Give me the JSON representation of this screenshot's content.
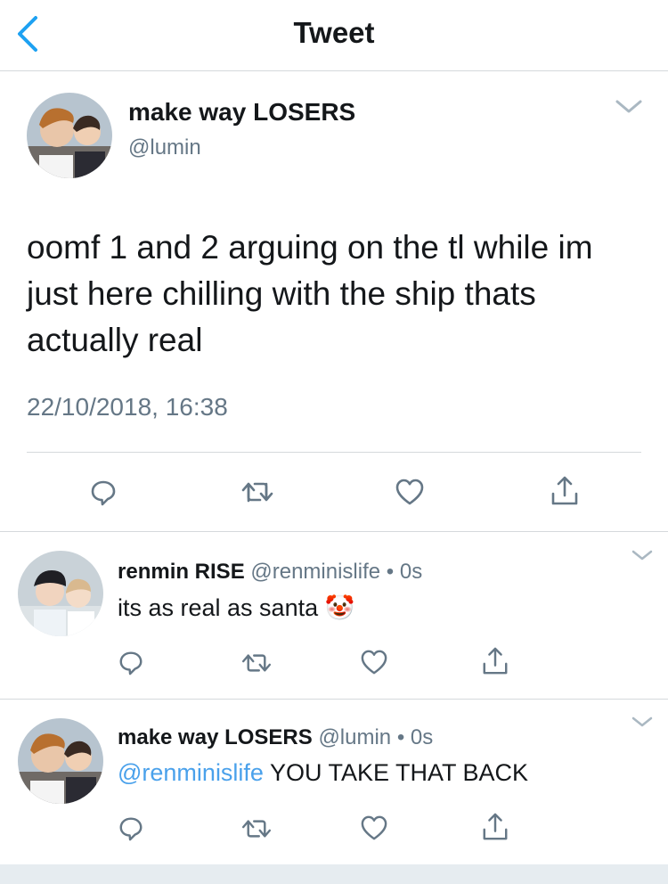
{
  "nav": {
    "title": "Tweet",
    "back_icon": "chevron-left-icon"
  },
  "colors": {
    "accent": "#1da1f2",
    "mention": "#4aa1eb",
    "muted": "#657786",
    "text": "#14171a",
    "divider": "#d5d9dc"
  },
  "tweet": {
    "author_name": "make way LOSERS",
    "author_handle": "@lumin",
    "text": "oomf 1 and 2 arguing on the tl while im just here chilling with the ship thats actually real",
    "timestamp": "22/10/2018, 16:38",
    "actions": [
      "reply-icon",
      "retweet-icon",
      "like-icon",
      "share-icon"
    ]
  },
  "replies": [
    {
      "author_name": "renmin RISE",
      "author_handle": "@renminislife",
      "separator": "•",
      "time": "0s",
      "text": "its as real as santa",
      "emoji": "🤡"
    },
    {
      "author_name": "make way LOSERS",
      "author_handle": "@lumin",
      "separator": "•",
      "time": "0s",
      "mention": "@renminislife",
      "text": "YOU TAKE THAT BACK"
    }
  ]
}
